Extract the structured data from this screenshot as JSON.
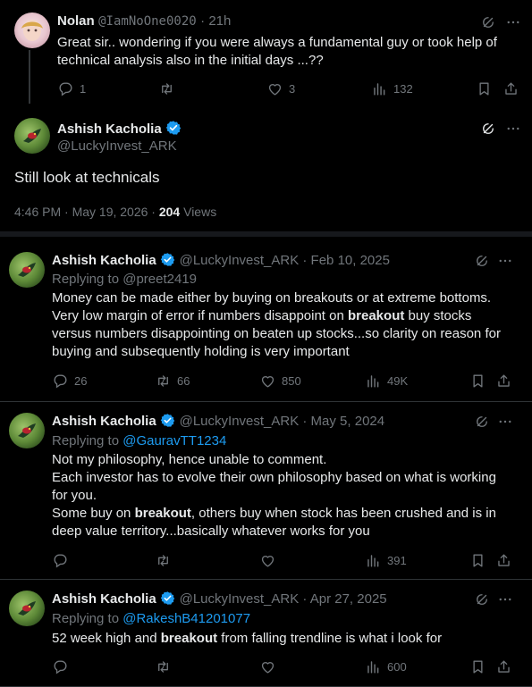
{
  "top_reply": {
    "name": "Nolan",
    "handle": "@IamNoOne0020",
    "time": "21h",
    "text": "Great sir.. wondering if you were always a fundamental guy or  took help of technical analysis also in the initial days ...??",
    "replies": "1",
    "likes": "3",
    "views": "132"
  },
  "main_tweet": {
    "name": "Ashish Kacholia",
    "handle": "@LuckyInvest_ARK",
    "text": "Still look at technicals",
    "timestamp": "4:46 PM · May 19, 2026 · ",
    "views_count": "204",
    "views_label": " Views"
  },
  "tweets": [
    {
      "name": "Ashish Kacholia",
      "handle_date": "@LuckyInvest_ARK · Feb 10, 2025",
      "replying_prefix": "Replying to ",
      "replying_to": "@preet2419",
      "line1": "Money can be made either by buying on breakouts or at extreme bottoms.",
      "line2a": "Very low margin of error if numbers disappoint on ",
      "line2b": "breakout",
      "line2c": " buy stocks",
      "line3": "versus numbers disappointing on beaten up stocks...so clarity on reason for",
      "line4": "buying and subsequently holding is very important",
      "replies": "26",
      "retweets": "66",
      "likes": "850",
      "views": "49K"
    },
    {
      "name": "Ashish Kacholia",
      "handle_date": "@LuckyInvest_ARK · May 5, 2024",
      "replying_prefix": "Replying to ",
      "replying_to": "@GauravTT1234",
      "line1": "Not my philosophy, hence unable to comment.",
      "line2": "Each investor has to evolve their own philosophy based on what is working",
      "line3": "for you.",
      "line4a": "Some buy on ",
      "line4b": "breakout",
      "line4c": ", others buy when stock has been crushed and is in",
      "line5": "deep value territory...basically whatever works for you",
      "views": "391"
    },
    {
      "name": "Ashish Kacholia",
      "handle_date": "@LuckyInvest_ARK · Apr 27, 2025",
      "replying_prefix": "Replying to ",
      "replying_to": "@RakeshB41201077",
      "line1a": "52 week high and ",
      "line1b": "breakout",
      "line1c": " from falling trendline is what i look for",
      "views": "600"
    }
  ],
  "colors": {
    "background": "#000000",
    "text": "#e7e9ea",
    "muted": "#71767b",
    "link": "#1d9bf0",
    "verified": "#1d9bf0",
    "separator": "#2f3336"
  }
}
